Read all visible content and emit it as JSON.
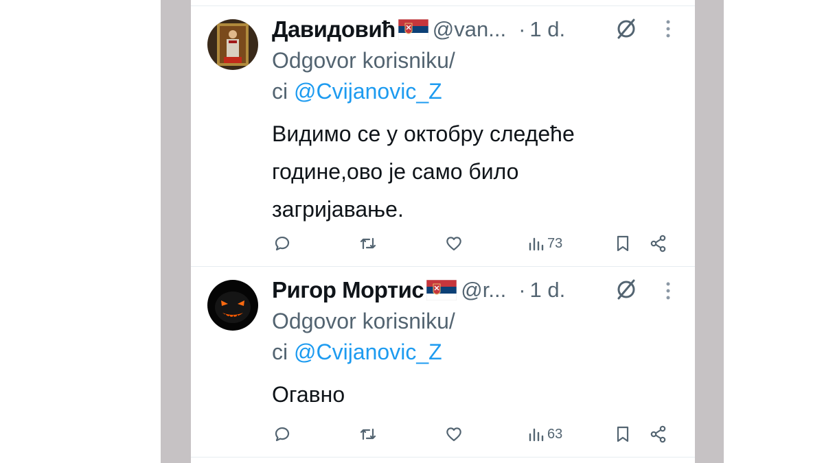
{
  "tweets": [
    {
      "name": "Давидовић",
      "handle": "@van...",
      "dot": "·",
      "time": "1 d.",
      "reply_prefix": "Odgovor korisniku/",
      "reply_prefix2": "ci",
      "mention": "@Cvijanovic_Z",
      "text_lines": [
        "Видимо се у октобру следеће",
        "године,ово је само било",
        "загријавање."
      ],
      "views": "73",
      "avatar": "icon-portrait"
    },
    {
      "name": "Ригор Мортис",
      "handle": "@r...",
      "dot": "·",
      "time": "1 d.",
      "reply_prefix": "Odgovor korisniku/",
      "reply_prefix2": "ci",
      "mention": "@Cvijanovic_Z",
      "text_lines": [
        "Огавно"
      ],
      "views": "63",
      "avatar": "pumpkin-face"
    }
  ],
  "colors": {
    "text": "#0f1419",
    "secondary": "#536471",
    "link": "#1d9bf0",
    "side_bars": "#c6c2c4"
  }
}
